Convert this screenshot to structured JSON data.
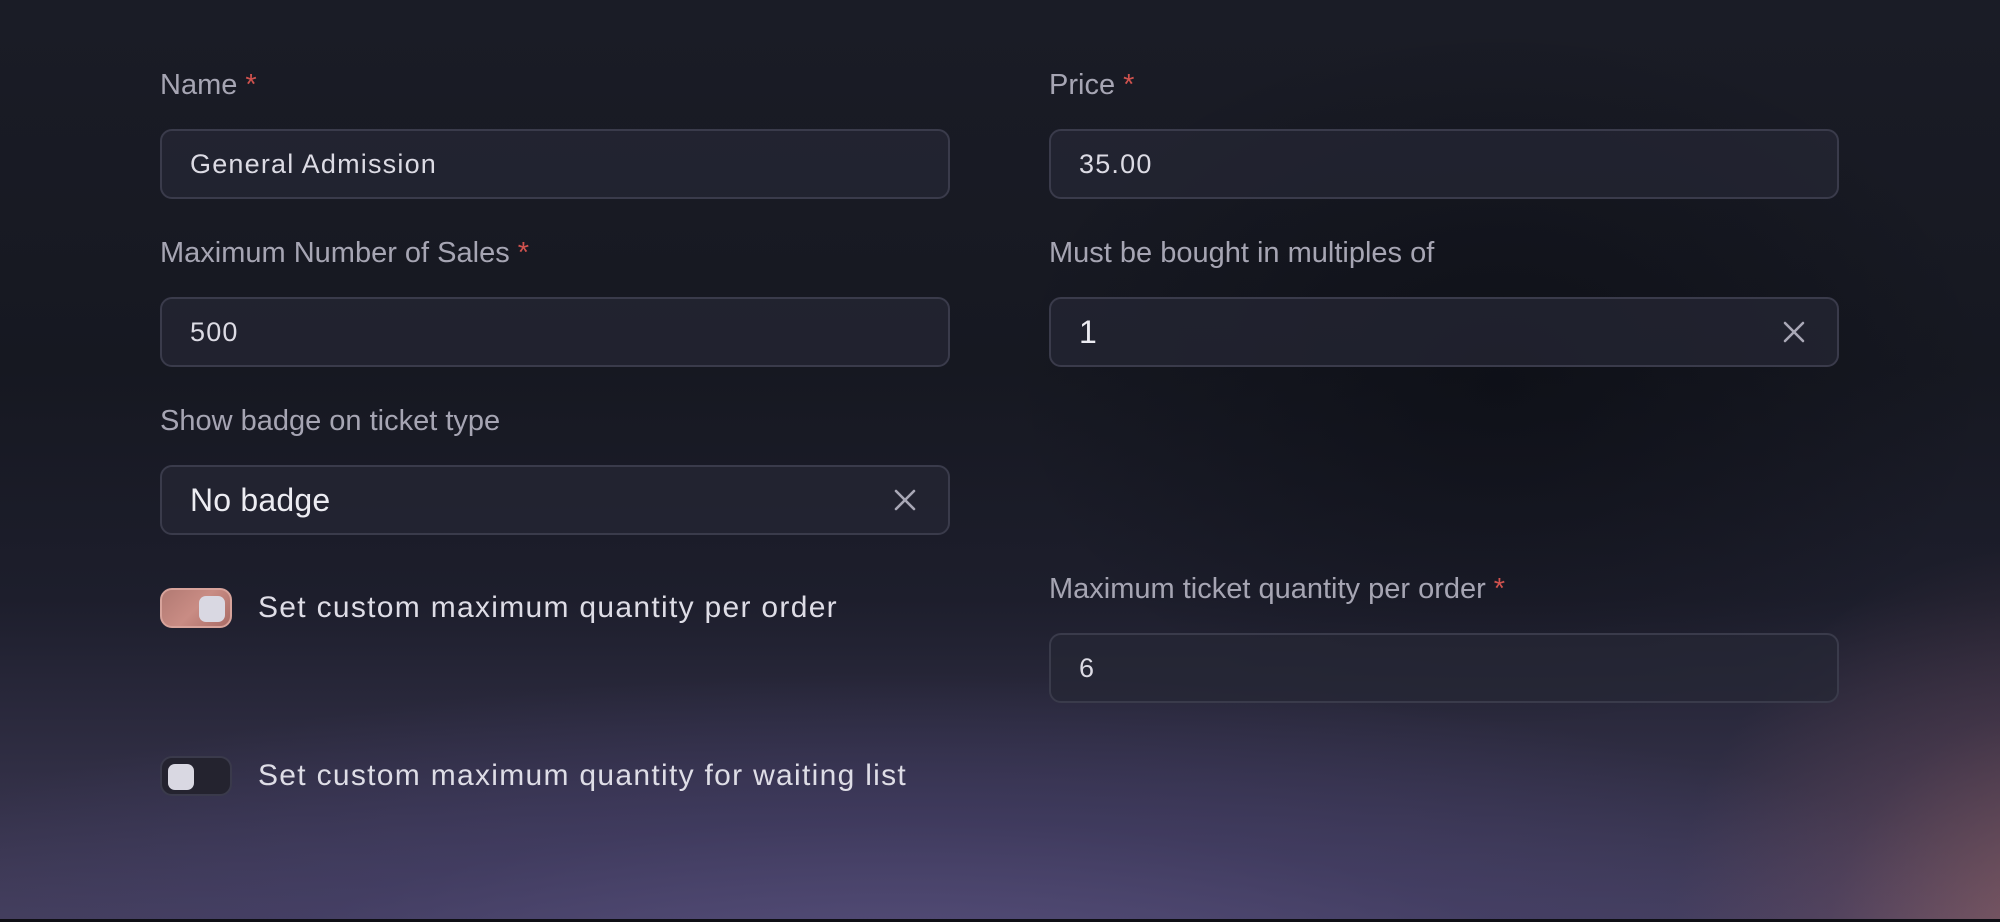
{
  "form": {
    "name": {
      "label": "Name",
      "required_mark": "*",
      "value": "General Admission"
    },
    "price": {
      "label": "Price",
      "required_mark": "*",
      "value": "35.00"
    },
    "max_sales": {
      "label": "Maximum Number of Sales",
      "required_mark": "*",
      "value": "500"
    },
    "multiples": {
      "label": "Must be bought in multiples of",
      "value": "1",
      "clear_icon": "close-icon"
    },
    "badge": {
      "label": "Show badge on ticket type",
      "value": "No badge",
      "clear_icon": "close-icon"
    },
    "custom_max_per_order": {
      "label": "Set custom maximum quantity per order",
      "enabled": true
    },
    "max_per_order": {
      "label": "Maximum ticket quantity per order",
      "required_mark": "*",
      "value": "6"
    },
    "custom_max_waiting_list": {
      "label": "Set custom maximum quantity for waiting list",
      "enabled": false
    }
  },
  "colors": {
    "required": "#d0524e",
    "toggle_on": "#c98c84",
    "toggle_off": "#24232f",
    "label": "#a6a5b3",
    "input_border": "#3a3b4b"
  }
}
